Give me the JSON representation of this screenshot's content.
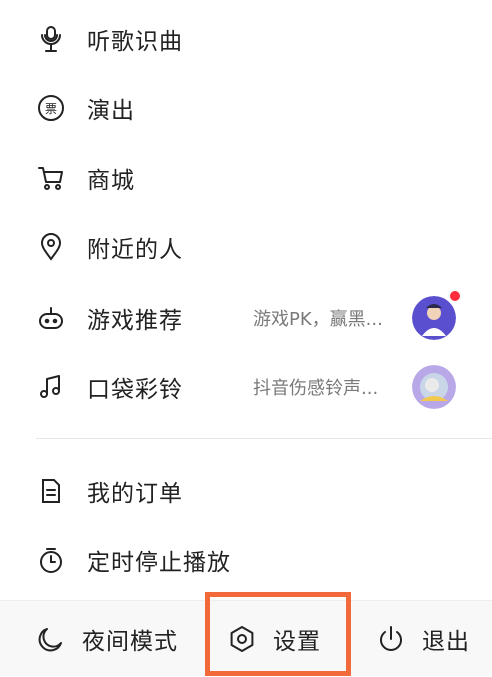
{
  "menu": {
    "items": [
      {
        "label": "听歌识曲",
        "icon": "microphone-music-icon"
      },
      {
        "label": "演出",
        "icon": "ticket-icon"
      },
      {
        "label": "商城",
        "icon": "cart-icon"
      },
      {
        "label": "附近的人",
        "icon": "location-pin-icon"
      },
      {
        "label": "游戏推荐",
        "icon": "game-controller-icon",
        "sub": "游戏PK，赢黑..."
      },
      {
        "label": "口袋彩铃",
        "icon": "music-note-icon",
        "sub": "抖音伤感铃声..."
      },
      {
        "label": "我的订单",
        "icon": "order-document-icon"
      },
      {
        "label": "定时停止播放",
        "icon": "timer-icon"
      }
    ]
  },
  "bottom_bar": {
    "night_mode": "夜间模式",
    "settings": "设置",
    "logout": "退出"
  },
  "colors": {
    "highlight": "#f26a3a",
    "badge": "#ff2d3b",
    "text": "#222222",
    "subtext": "#7a7a7a"
  }
}
